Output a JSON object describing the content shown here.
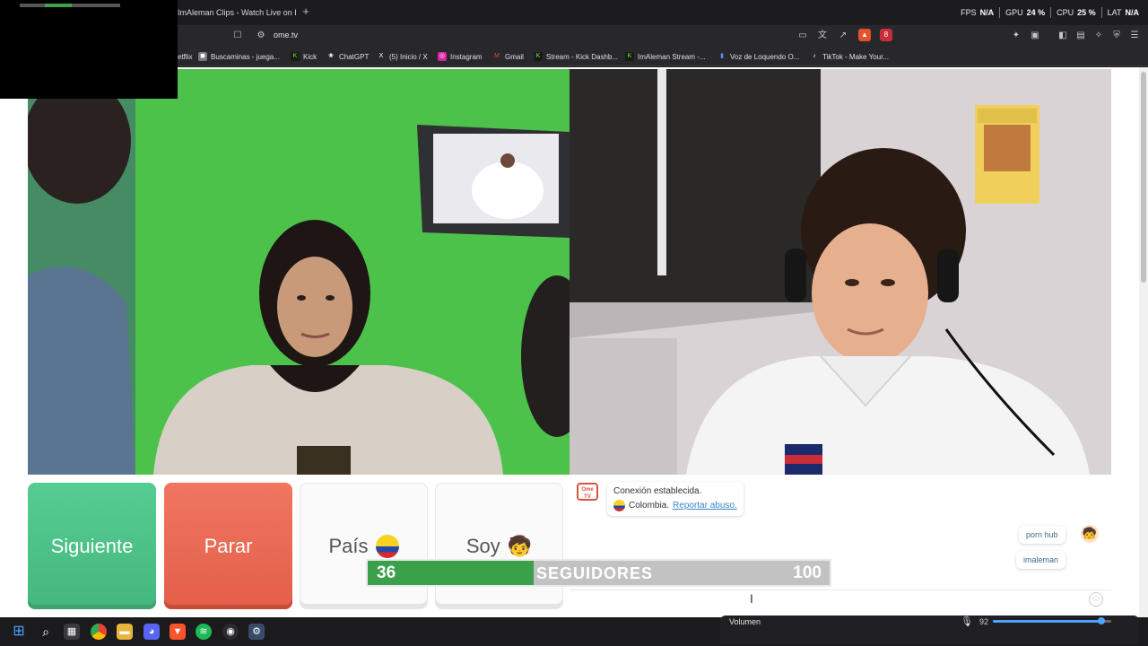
{
  "browser": {
    "active_tab_title": "ImAleman Clips - Watch Live on Kick",
    "new_tab_symbol": "+",
    "url": "ome.tv",
    "perf_stats": [
      {
        "label": "FPS",
        "value": "N/A"
      },
      {
        "label": "GPU",
        "value": "24 %"
      },
      {
        "label": "CPU",
        "value": "25 %"
      },
      {
        "label": "LAT",
        "value": "N/A"
      }
    ],
    "bookmarks": [
      {
        "label": "etflix",
        "icon": "netflix-icon",
        "color": "#e50914"
      },
      {
        "label": "Buscaminas - juega...",
        "icon": "minesweeper-icon",
        "color": "#7a7a7a"
      },
      {
        "label": "Kick",
        "icon": "kick-icon",
        "color": "#53fc18"
      },
      {
        "label": "ChatGPT",
        "icon": "chatgpt-icon",
        "color": "#555555"
      },
      {
        "label": "(5) Inicio / X",
        "icon": "x-icon",
        "color": "#000000"
      },
      {
        "label": "Instagram",
        "icon": "instagram-icon",
        "color": "#d6249f"
      },
      {
        "label": "Gmail",
        "icon": "gmail-icon",
        "color": "#ea4335"
      },
      {
        "label": "Stream - Kick Dashb...",
        "icon": "kick-icon",
        "color": "#53fc18"
      },
      {
        "label": "ImAleman Stream -...",
        "icon": "kick-icon",
        "color": "#53fc18"
      },
      {
        "label": "Voz de Loquendo O...",
        "icon": "audio-icon",
        "color": "#3a6fd8"
      },
      {
        "label": "TikTok - Make Your...",
        "icon": "tiktok-icon",
        "color": "#000000"
      }
    ],
    "extension_badge": "8"
  },
  "controls": {
    "next_label": "Siguiente",
    "stop_label": "Parar",
    "country_label": "País",
    "me_label": "Soy",
    "me_emoji": "🧒"
  },
  "chat": {
    "logo_text": "Ome TV",
    "system_line1": "Conexión establecida.",
    "system_country": "Colombia.",
    "system_report_link": "Reportar abuso.",
    "messages": [
      "porn hub",
      "imaleman"
    ]
  },
  "follower_goal": {
    "current": "36",
    "label": "SEGUIDORES",
    "target": "100",
    "progress": 0.36
  },
  "volume": {
    "label": "Volumen",
    "value": "92",
    "level": 0.92
  },
  "colors": {
    "next_button": "#4fc48a",
    "stop_button": "#ea6b55",
    "goal_fill": "#3aa14a",
    "goal_track": "#c2c2c2",
    "link": "#3a86c8"
  }
}
